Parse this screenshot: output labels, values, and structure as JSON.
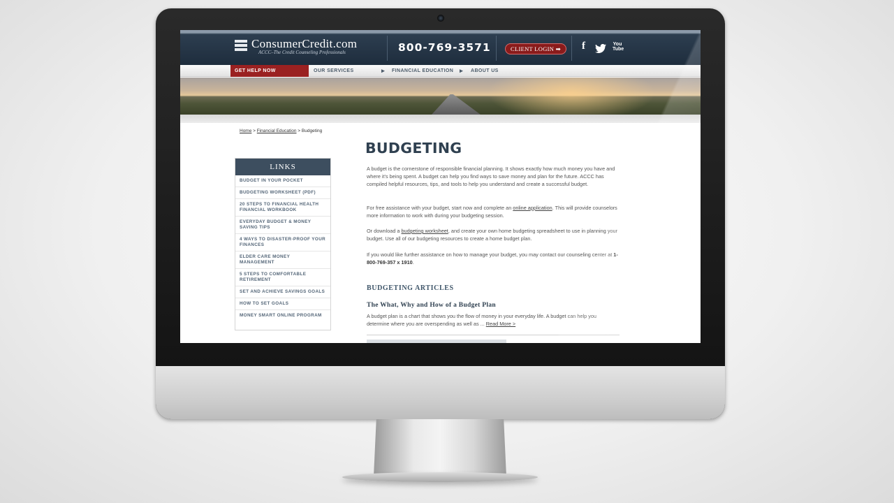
{
  "header": {
    "logo_text": "ConsumerCredit.com",
    "logo_tagline": "ACCC–The Credit Counseling Professionals",
    "phone": "800-769-3571",
    "client_login": "CLIENT LOGIN ➡",
    "social": {
      "facebook": "f",
      "twitter": "twitter-icon",
      "youtube": "You Tube"
    }
  },
  "nav": {
    "items": [
      {
        "label": "GET HELP NOW"
      },
      {
        "label": "OUR SERVICES"
      },
      {
        "label": "FINANCIAL EDUCATION"
      },
      {
        "label": "ABOUT US"
      }
    ]
  },
  "breadcrumb": {
    "home": "Home",
    "sep1": " > ",
    "financial_education": "Financial Education",
    "sep2": " > ",
    "current": "Budgeting"
  },
  "sidebar": {
    "title": "LINKS",
    "items": [
      {
        "label": "BUDGET IN YOUR POCKET"
      },
      {
        "label": "BUDGETING WORKSHEET (PDF)"
      },
      {
        "label": "20 STEPS TO FINANCIAL HEALTH FINANCIAL WORKBOOK"
      },
      {
        "label": "EVERYDAY BUDGET & MONEY SAVING TIPS"
      },
      {
        "label": "4 WAYS TO DISASTER-PROOF YOUR FINANCES"
      },
      {
        "label": "ELDER CARE MONEY MANAGEMENT"
      },
      {
        "label": "5 STEPS TO COMFORTABLE RETIREMENT"
      },
      {
        "label": "SET AND ACHIEVE SAVINGS GOALS"
      },
      {
        "label": "HOW TO SET GOALS"
      },
      {
        "label": "MONEY SMART ONLINE PROGRAM"
      }
    ]
  },
  "main": {
    "title": "BUDGETING",
    "p1": "A budget is the cornerstone of responsible financial planning. It shows exactly how much money you have and where it's being spent. A budget can help you find ways to save money and plan for the future. ACCC has compiled helpful resources, tips, and tools to help you understand and create a successful budget.",
    "p2_a": "For free assistance with your budget, start now and complete an ",
    "p2_link": "online application",
    "p2_b": ". This will provide counselors more information to work with during your budgeting session.",
    "p3_a": "Or download a ",
    "p3_link": "budgeting worksheet",
    "p3_b": ", and create your own home budgeting spreadsheet to use in planning your budget. Use all of our budgeting resources to create a home budget plan.",
    "p4_a": "If you would like further assistance on how to manage your budget, you may contact our counseling center at ",
    "p4_phone": "1-800-769-357 x 1910",
    "p4_b": ".",
    "articles_heading": "BUDGETING ARTICLES",
    "article1_title": "The What, Why and How of a Budget Plan",
    "article1_text": "A budget plan is a chart that shows you the flow of money in your everyday life. A budget can help you determine where you are overspending as well as ... ",
    "article1_link": "Read More >"
  }
}
